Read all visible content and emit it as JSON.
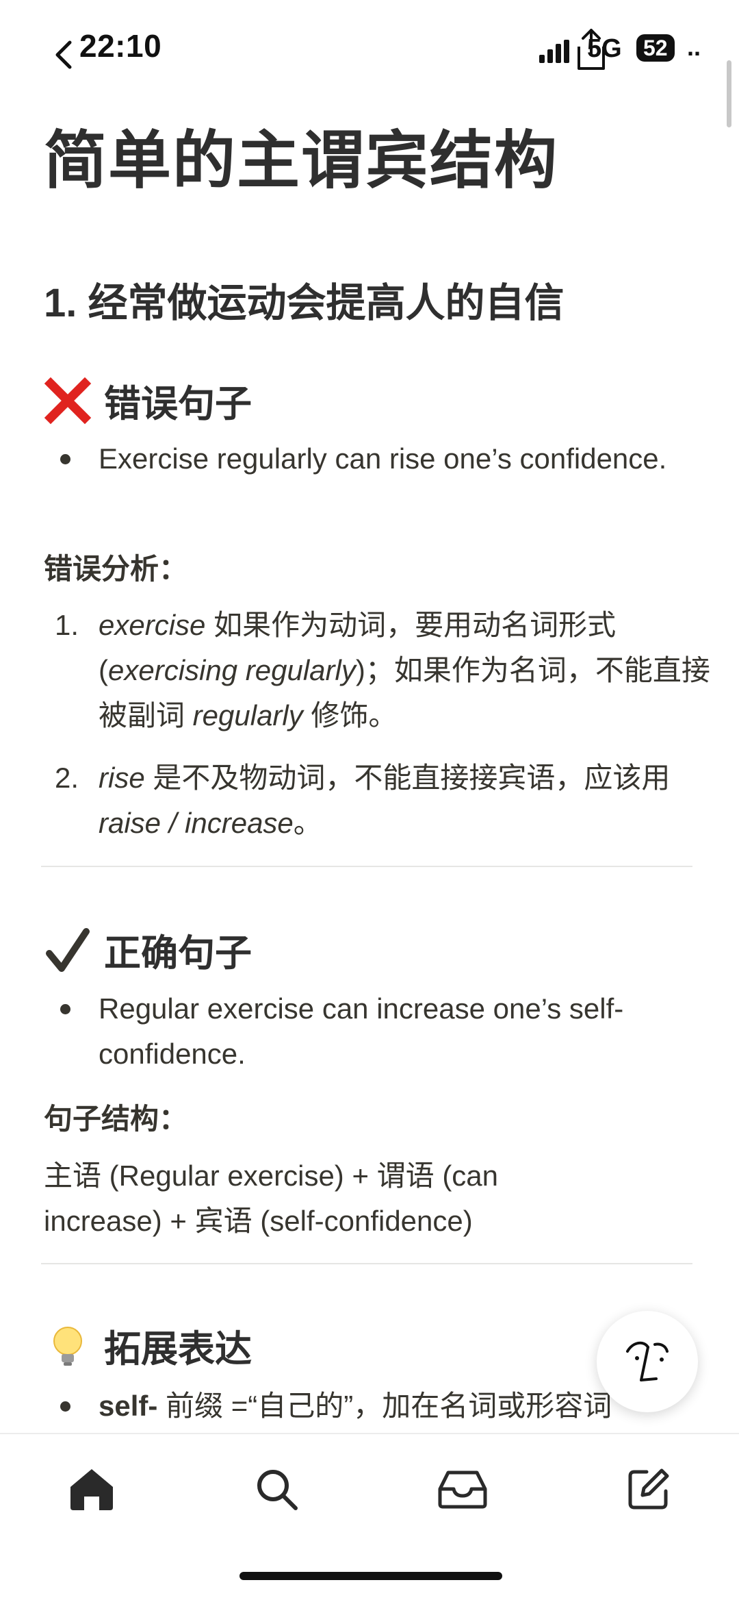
{
  "status_bar": {
    "time": "22:10",
    "network": "5G",
    "battery": "52"
  },
  "page": {
    "title": "简单的主谓宾结构"
  },
  "section1": {
    "heading": "1. 经常做运动会提高人的自信",
    "wrong": {
      "title": "错误句子",
      "sentence": "Exercise regularly can rise one’s confidence.",
      "analysis_label": "错误分析：",
      "analysis": [
        {
          "num": "1.",
          "parts": [
            "exercise",
            " 如果作为动词，要用动名词形式 (",
            "exercising regularly",
            ")；如果作为名词，不能直接被副词 ",
            "regularly",
            " 修饰。"
          ]
        },
        {
          "num": "2.",
          "parts": [
            "rise",
            " 是不及物动词，不能直接接宾语，应该用 ",
            "raise / increase",
            "。"
          ]
        }
      ]
    },
    "correct": {
      "title": "正确句子",
      "sentence": "Regular exercise can increase one’s self-confidence.",
      "structure_label": "句子结构：",
      "structure": "主语 (Regular exercise) + 谓语 (can increase) + 宾语 (self-confidence)"
    },
    "expand": {
      "title": "拓展表达",
      "item_bold": "self-",
      "item_text": " 前缀 =“自己的”，加在名词或形容词"
    }
  },
  "icons": {
    "back": "chevron-left-icon",
    "signal": "signal-icon",
    "share": "share-icon",
    "wrong": "cross-mark-icon",
    "correct": "check-mark-icon",
    "expand": "light-bulb-icon",
    "ai": "notion-ai-face-icon",
    "home": "home-icon",
    "search": "search-icon",
    "inbox": "inbox-icon",
    "compose": "compose-icon"
  },
  "colors": {
    "text": "#37352f",
    "heading": "#2f2f2f",
    "cross": "#e0231f",
    "divider": "#e6e6e4"
  }
}
